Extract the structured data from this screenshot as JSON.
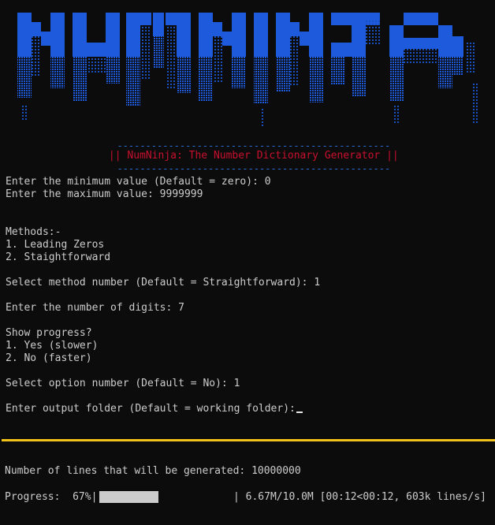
{
  "banner": {
    "logo_text": "NUMNINJA",
    "color": "#1e5bdc"
  },
  "header": {
    "dashes": "------------------------------------------------",
    "title": "|| NumNinja: The Number Dictionary Generator ||"
  },
  "prompts": {
    "min_value": "Enter the minimum value (Default = zero): 0",
    "max_value": "Enter the maximum value: 9999999",
    "methods_heading": "Methods:-",
    "method_1": "1. Leading Zeros",
    "method_2": "2. Staightforward",
    "select_method": "Select method number (Default = Straightforward): 1",
    "digits": "Enter the number of digits: 7",
    "show_progress": "Show progress?",
    "progress_opt_1": "1. Yes (slower)",
    "progress_opt_2": "2. No (faster)",
    "select_option": "Select option number (Default = No): 1",
    "output_folder": "Enter output folder (Default = working folder):"
  },
  "status": {
    "lines_generated": "Number of lines that will be generated: 10000000",
    "progress_label": "Progress:  67%|",
    "progress_fraction": 0.67,
    "progress_stats": "| 6.67M/10.0M [00:12<00:12, 603k lines/s]"
  },
  "colors": {
    "background": "#0c0c0c",
    "text": "#cccccc",
    "title_red": "#c8102e",
    "dash_blue": "#2a6fd6",
    "divider_yellow": "#f2c31b"
  }
}
